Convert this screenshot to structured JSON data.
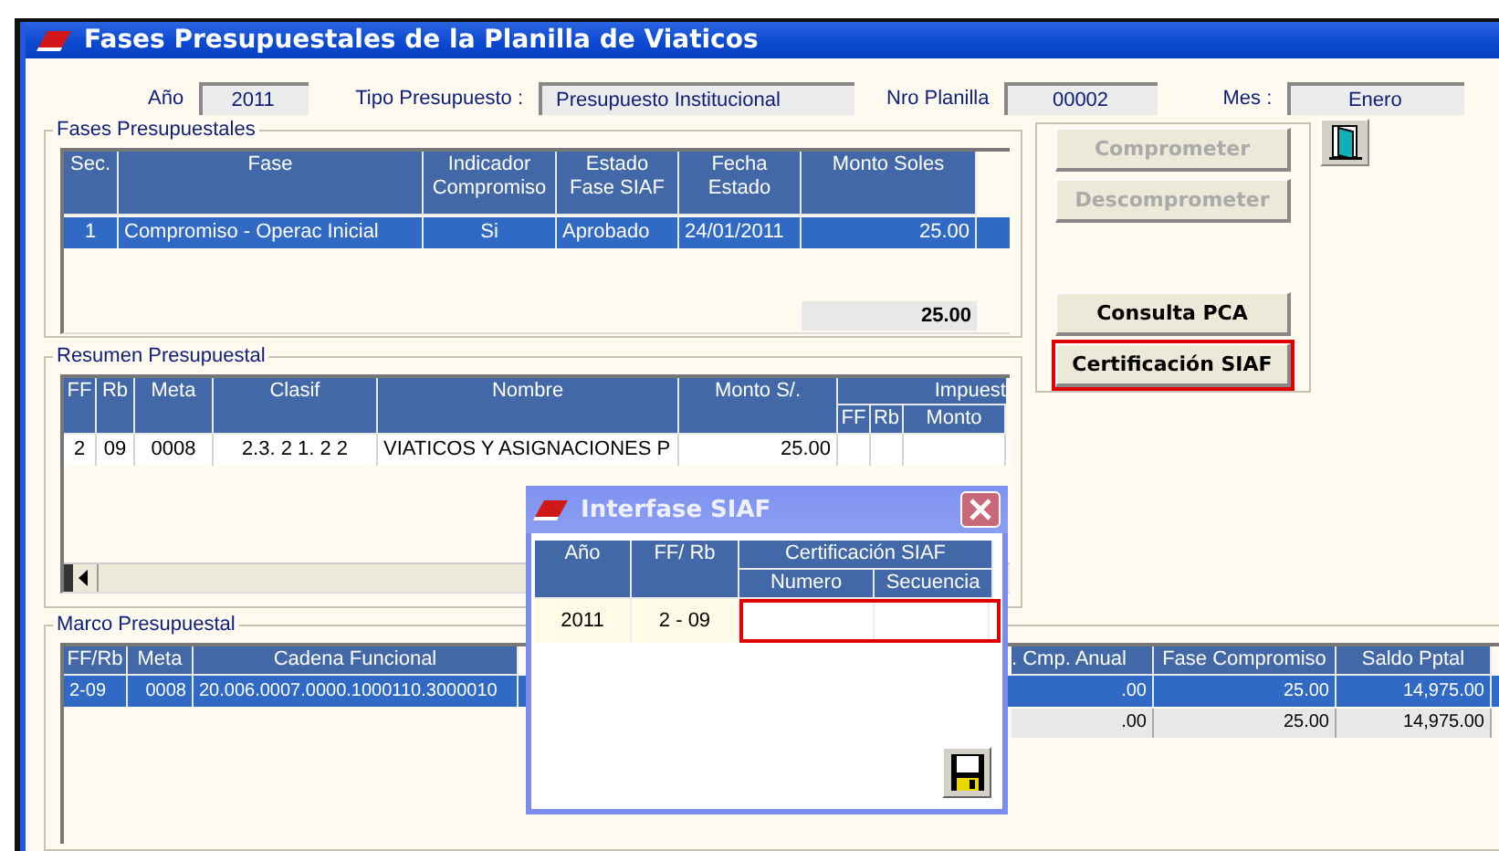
{
  "window": {
    "title": "Fases Presupuestales de la Planilla de Viaticos"
  },
  "header": {
    "fields": [
      {
        "label": "Año",
        "value": "2011"
      },
      {
        "label": "Tipo Presupuesto :",
        "value": "Presupuesto Institucional"
      },
      {
        "label": "Nro Planilla",
        "value": "00002"
      },
      {
        "label": "Mes :",
        "value": "Enero"
      }
    ]
  },
  "fases": {
    "title": "Fases Presupuestales",
    "columns": [
      "Sec.",
      "Fase",
      "Indicador\nCompromiso",
      "Estado\nFase SIAF",
      "Fecha\nEstado",
      "Monto Soles"
    ],
    "rows": [
      {
        "cells": [
          "1",
          "Compromiso - Operac Inicial",
          "Si",
          "Aprobado",
          "24/01/2011",
          "25.00"
        ],
        "selected": true
      }
    ],
    "total": "25.00"
  },
  "actions": {
    "buttons": [
      {
        "label": "Comprometer",
        "disabled": true,
        "highlighted": false
      },
      {
        "label": "Descomprometer",
        "disabled": true,
        "highlighted": false
      },
      {
        "label": "Consulta PCA",
        "disabled": false,
        "highlighted": false
      },
      {
        "label": "Certificación SIAF",
        "disabled": false,
        "highlighted": true
      }
    ]
  },
  "resumen": {
    "title": "Resumen Presupuestal",
    "columns": [
      "FF",
      "Rb",
      "Meta",
      "Clasif",
      "Nombre",
      "Monto S/."
    ],
    "group": {
      "label": "Impuest",
      "columns": [
        "FF",
        "Rb",
        "Monto"
      ]
    },
    "rows": [
      {
        "cells": [
          "2",
          "09",
          "0008",
          "2.3. 2  1. 2  2",
          "VIATICOS Y ASIGNACIONES P",
          "25.00"
        ],
        "selected": false
      }
    ]
  },
  "marco": {
    "title": "Marco Presupuestal",
    "columns": [
      "FF/Rb",
      "Meta",
      "Cadena Funcional",
      ". Cmp. Anual",
      "Fase Compromiso",
      "Saldo Pptal"
    ],
    "rows": [
      {
        "cells": [
          "2-09",
          "0008",
          "20.006.0007.0000.1000110.3000010",
          ".00",
          "25.00",
          "14,975.00"
        ],
        "selected": true
      }
    ],
    "totals": [
      ".00",
      "25.00",
      "14,975.00"
    ]
  },
  "dialog": {
    "title": "Interfase SIAF",
    "columns": [
      "Año",
      "FF/ Rb"
    ],
    "group": {
      "label": "Certificación SIAF",
      "columns": [
        "Numero",
        "Secuencia"
      ]
    },
    "rows": [
      {
        "cells": [
          "2011",
          "2 - 09"
        ]
      }
    ],
    "highlighted": true
  }
}
